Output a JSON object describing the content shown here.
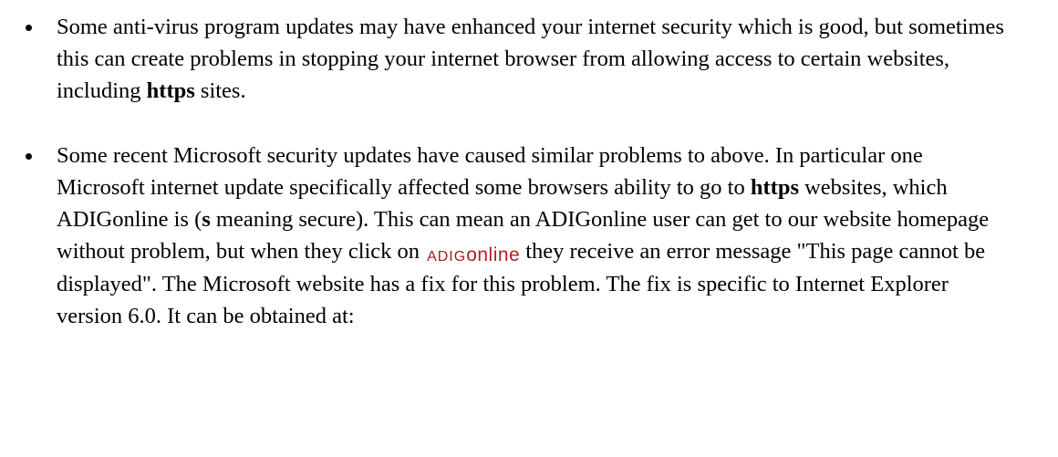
{
  "bullets": [
    {
      "text1": "Some anti-virus program updates may have enhanced your internet security which is good, but sometimes this can create problems in stopping your internet browser from allowing access to certain websites, including ",
      "bold1": "https",
      "text2": " sites."
    },
    {
      "text1": "Some recent Microsoft security updates have caused similar problems to above. In particular one Microsoft internet update specifically affected some browsers ability to go to ",
      "bold1": "https",
      "text2": " websites, which ADIGonline is (",
      "bold2": "s",
      "text3": " meaning secure). This can mean an ADIGonline user can get to our website homepage without problem, but when they click on",
      "text4": "they receive an error message \"This page cannot be displayed\". The Microsoft website has a fix for this problem. The fix is specific to Internet Explorer version 6.0. It can be obtained at:"
    }
  ],
  "logo": {
    "part1": "ADIG",
    "part2": "online",
    "color": "#a61e1e"
  }
}
